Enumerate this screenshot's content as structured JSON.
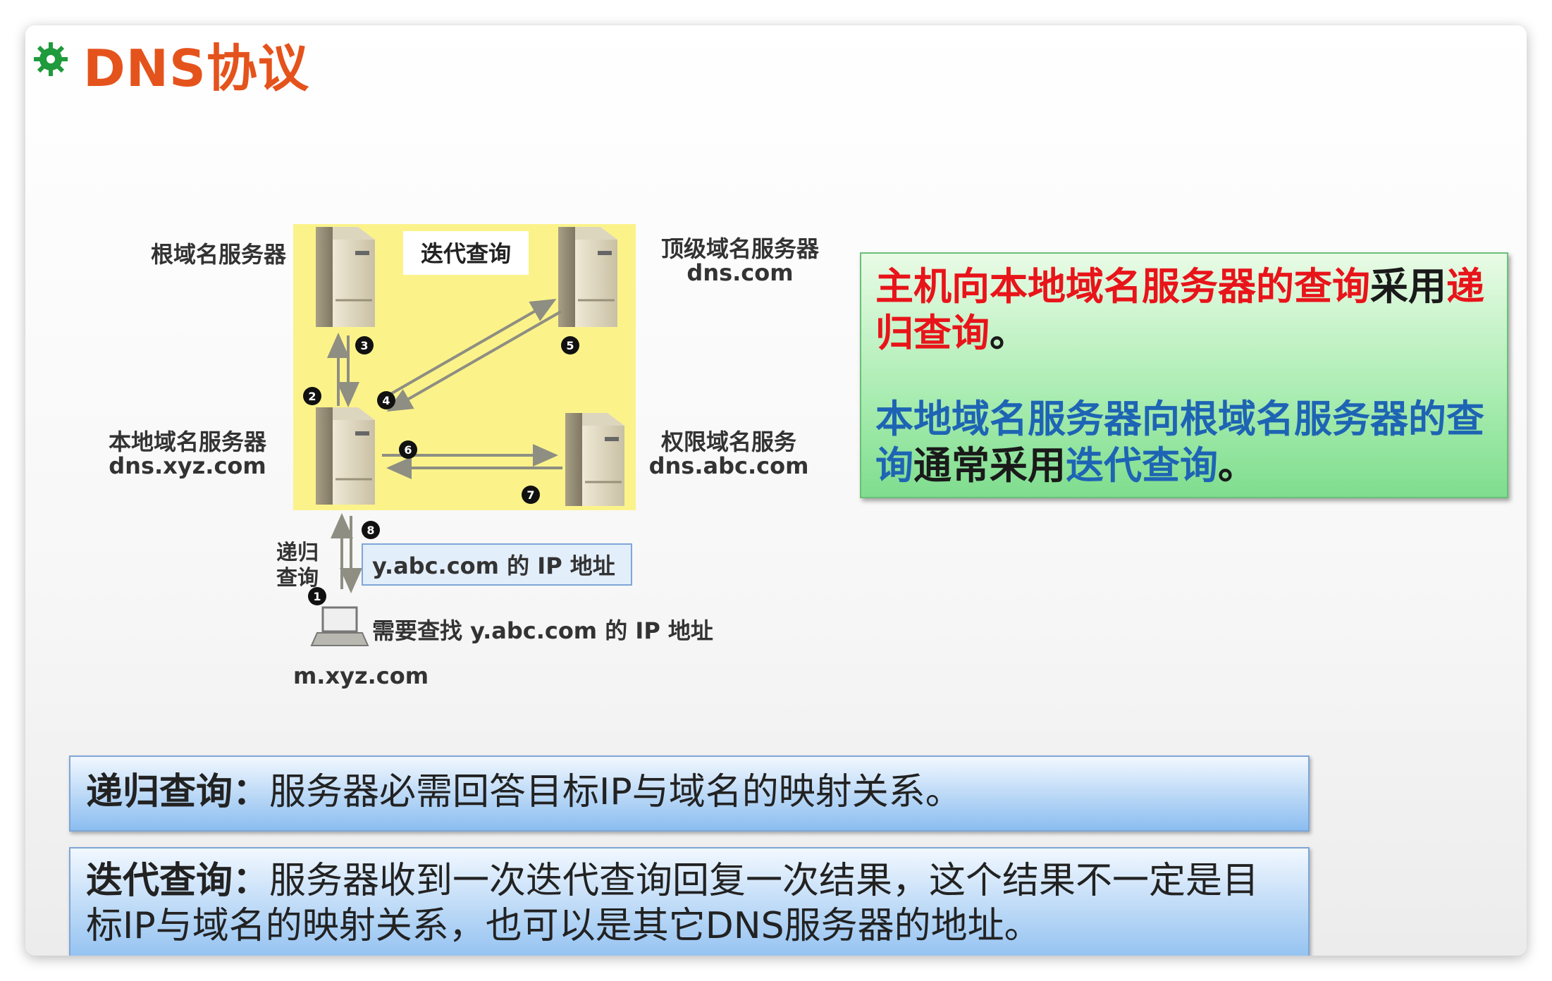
{
  "slide": {
    "title": "DNS协议",
    "bullet_icon": "green-gear-bullet-icon"
  },
  "diagram": {
    "box_label": "迭代查询",
    "root_server": {
      "label": "根域名服务器"
    },
    "tld_server": {
      "label": "顶级域名服务器",
      "domain": "dns.com"
    },
    "local_server": {
      "label": "本地域名服务器",
      "domain": "dns.xyz.com"
    },
    "auth_server": {
      "label": "权限域名服务",
      "domain": "dns.abc.com"
    },
    "recursive_label_1": "递归",
    "recursive_label_2": "查询",
    "answer_box": "y.abc.com 的 IP 地址",
    "host_query": "需要查找 y.abc.com 的 IP 地址",
    "host_name": "m.xyz.com",
    "steps": [
      "1",
      "2",
      "3",
      "4",
      "5",
      "6",
      "7",
      "8"
    ],
    "colors": {
      "box_fill": "#fbf38a",
      "server": "#d8d0b8",
      "arrow": "#9a9a8e"
    }
  },
  "callout": {
    "line1_red_a": "主机向本地域名服务器的查询",
    "line1_dark": "采用",
    "line1_red_b": "递归查询",
    "line1_end": "。",
    "line2_blue_a": "本地域名服务器向根域名服务器的查询",
    "line2_dark": "通常采用",
    "line2_blue_b": "迭代查询",
    "line2_end": "。"
  },
  "definitions": {
    "recursive_term": "递归查询：",
    "recursive_text": "服务器必需回答目标IP与域名的映射关系。",
    "iterative_term": "迭代查询：",
    "iterative_text": "服务器收到一次迭代查询回复一次结果，这个结果不一定是目标IP与域名的映射关系，也可以是其它DNS服务器的地址。"
  },
  "colors": {
    "title": "#e5531c",
    "red": "#e8141a",
    "blue": "#1e64b4",
    "callout_bg": "#a8ecb0",
    "bar_bg": "#b8d7f6"
  }
}
